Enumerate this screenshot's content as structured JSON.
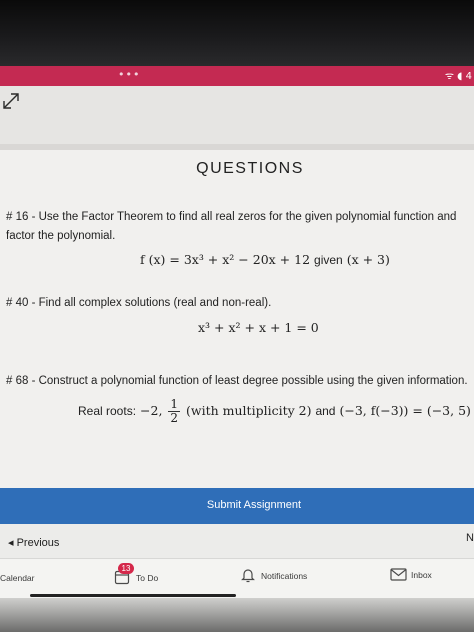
{
  "status": {
    "dots": "•••",
    "icons": "ᯤ ◖ 4"
  },
  "page": {
    "title": "QUESTIONS"
  },
  "questions": [
    {
      "text": "# 16 - Use the Factor Theorem to find all real zeros for the given polynomial function and factor the polynomial.",
      "math_lhs": "f (x) = 3x³ + x² − 20x + 12",
      "math_given": "given",
      "math_rhs": "(x + 3)"
    },
    {
      "text": "# 40 - Find all complex solutions (real and non-real).",
      "math": "x³ + x² + x + 1 = 0"
    },
    {
      "text": "# 68 - Construct a polynomial function of least degree possible using the given information.",
      "math_label": "Real roots:",
      "math_part1": "−2,",
      "frac_num": "1",
      "frac_den": "2",
      "math_part2": "(with multiplicity 2)",
      "math_and": "and",
      "math_part3": "(−3, f(−3)) = (−3, 5)"
    }
  ],
  "actions": {
    "submit_label": "Submit Assignment",
    "previous_label": "◂ Previous",
    "next_label": "N"
  },
  "tabbar": {
    "calendar_label": "Calendar",
    "todo_label": "To Do",
    "todo_badge": "13",
    "notifications_label": "Notifications",
    "inbox_label": "Inbox"
  },
  "colors": {
    "status_bar": "#c42a52",
    "submit_bar": "#2f6eb8",
    "badge": "#d4284a"
  }
}
